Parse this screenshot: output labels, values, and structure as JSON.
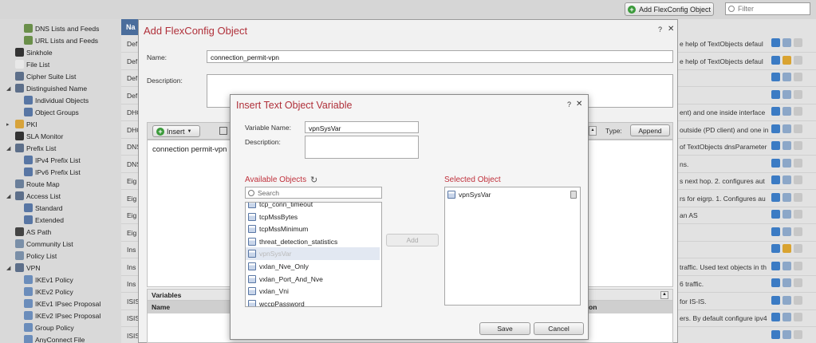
{
  "topbar": {
    "add_button": "Add FlexConfig Object",
    "filter_placeholder": "Filter"
  },
  "sidebar": {
    "items": [
      {
        "label": "DNS Lists and Feeds",
        "indent": 2
      },
      {
        "label": "URL Lists and Feeds",
        "indent": 2
      },
      {
        "label": "Sinkhole",
        "indent": 1
      },
      {
        "label": "File List",
        "indent": 1
      },
      {
        "label": "Cipher Suite List",
        "indent": 1
      },
      {
        "label": "Distinguished Name",
        "indent": 1,
        "expand": "◢"
      },
      {
        "label": "Individual Objects",
        "indent": 2
      },
      {
        "label": "Object Groups",
        "indent": 2
      },
      {
        "label": "PKI",
        "indent": 1,
        "expand": "▸"
      },
      {
        "label": "SLA Monitor",
        "indent": 1
      },
      {
        "label": "Prefix List",
        "indent": 1,
        "expand": "◢"
      },
      {
        "label": "IPv4 Prefix List",
        "indent": 2
      },
      {
        "label": "IPv6 Prefix List",
        "indent": 2
      },
      {
        "label": "Route Map",
        "indent": 1
      },
      {
        "label": "Access List",
        "indent": 1,
        "expand": "◢"
      },
      {
        "label": "Standard",
        "indent": 2
      },
      {
        "label": "Extended",
        "indent": 2
      },
      {
        "label": "AS Path",
        "indent": 1
      },
      {
        "label": "Community List",
        "indent": 1
      },
      {
        "label": "Policy List",
        "indent": 1
      },
      {
        "label": "VPN",
        "indent": 1,
        "expand": "◢"
      },
      {
        "label": "IKEv1 Policy",
        "indent": 2
      },
      {
        "label": "IKEv2 Policy",
        "indent": 2
      },
      {
        "label": "IKEv1 IPsec Proposal",
        "indent": 2
      },
      {
        "label": "IKEv2 IPsec Proposal",
        "indent": 2
      },
      {
        "label": "Group Policy",
        "indent": 2
      },
      {
        "label": "AnyConnect File",
        "indent": 2
      }
    ]
  },
  "grid": {
    "header": "Na",
    "rows": [
      {
        "name": "Def",
        "desc": "e help of TextObjects defaul",
        "edit": false
      },
      {
        "name": "Def",
        "desc": "e help of TextObjects defaul",
        "edit": true
      },
      {
        "name": "Def",
        "desc": "",
        "edit": false
      },
      {
        "name": "Def",
        "desc": "",
        "edit": false
      },
      {
        "name": "DHC",
        "desc": "ent) and one inside interface",
        "edit": false
      },
      {
        "name": "DHC",
        "desc": "outside (PD client) and one in",
        "edit": false
      },
      {
        "name": "DNS",
        "desc": "of TextObjects dnsParameter",
        "edit": false
      },
      {
        "name": "DNS",
        "desc": "ns.",
        "edit": false
      },
      {
        "name": "Eig",
        "desc": "s next hop. 2. configures aut",
        "edit": false
      },
      {
        "name": "Eig",
        "desc": "rs for eigrp. 1. Configures au",
        "edit": false
      },
      {
        "name": "Eig",
        "desc": "an AS",
        "edit": false
      },
      {
        "name": "Eig",
        "desc": "",
        "edit": false
      },
      {
        "name": "Ins",
        "desc": "",
        "edit": true
      },
      {
        "name": "Ins",
        "desc": "traffic. Used text objects in th",
        "edit": false
      },
      {
        "name": "Ins",
        "desc": "6 traffic.",
        "edit": false
      },
      {
        "name": "ISIS",
        "desc": "for IS-IS.",
        "edit": false
      },
      {
        "name": "ISIS",
        "desc": "ers. By default configure ipv4",
        "edit": false
      },
      {
        "name": "ISIS",
        "desc": "",
        "edit": false
      }
    ]
  },
  "flexconfig": {
    "title": "Add FlexConfig Object",
    "name_label": "Name:",
    "name_value": "connection_permit-vpn",
    "description_label": "Description:",
    "insert_button": "Insert",
    "type_label": "Type:",
    "type_value": "Append",
    "editor_text": "connection permit-vpn",
    "variables_title": "Variables",
    "variables_col_name": "Name",
    "variables_col_right": "on"
  },
  "insert_dialog": {
    "title": "Insert Text Object Variable",
    "variable_name_label": "Variable Name:",
    "variable_name_value": "vpnSysVar",
    "description_label": "Description:",
    "available_label": "Available Objects",
    "search_placeholder": "Search",
    "available_items": [
      {
        "label": "tcp_conn_timeout",
        "selected": false
      },
      {
        "label": "tcpMssBytes",
        "selected": false
      },
      {
        "label": "tcpMssMinimum",
        "selected": false
      },
      {
        "label": "threat_detection_statistics",
        "selected": false
      },
      {
        "label": "vpnSysVar",
        "selected": true
      },
      {
        "label": "vxlan_Nve_Only",
        "selected": false
      },
      {
        "label": "vxlan_Port_And_Nve",
        "selected": false
      },
      {
        "label": "vxlan_Vni",
        "selected": false
      },
      {
        "label": "wccpPassword",
        "selected": false
      }
    ],
    "add_button": "Add",
    "selected_label": "Selected Object",
    "selected_items": [
      {
        "label": "vpnSysVar"
      }
    ],
    "save_button": "Save",
    "cancel_button": "Cancel"
  },
  "colors": {
    "accent_title": "#b0303a",
    "grid_header": "#4a6d9c"
  }
}
